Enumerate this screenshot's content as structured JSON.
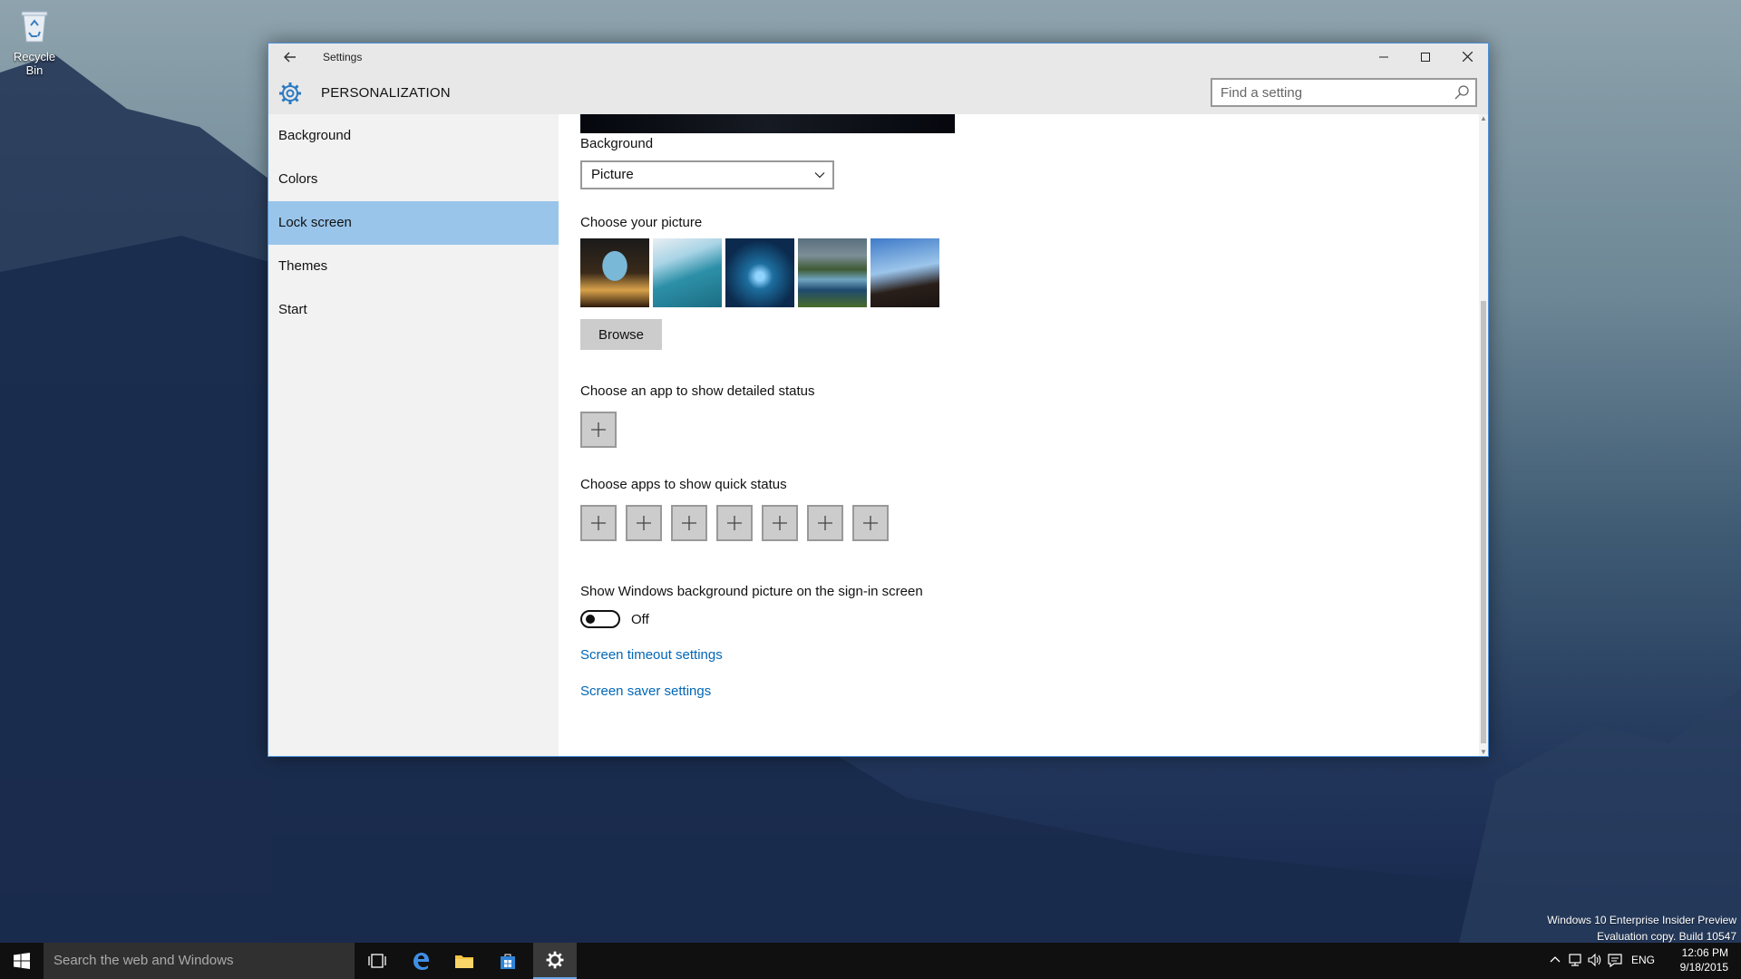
{
  "desktop": {
    "recycle_bin_label": "Recycle Bin"
  },
  "window": {
    "title": "Settings",
    "section": "PERSONALIZATION",
    "search_placeholder": "Find a setting"
  },
  "sidebar": {
    "items": [
      {
        "label": "Background",
        "active": false
      },
      {
        "label": "Colors",
        "active": false
      },
      {
        "label": "Lock screen",
        "active": true
      },
      {
        "label": "Themes",
        "active": false
      },
      {
        "label": "Start",
        "active": false
      }
    ]
  },
  "content": {
    "background_label": "Background",
    "background_value": "Picture",
    "choose_picture_label": "Choose your picture",
    "browse_label": "Browse",
    "detailed_status_label": "Choose an app to show detailed status",
    "quick_status_label": "Choose apps to show quick status",
    "signin_label": "Show Windows background picture on the sign-in screen",
    "signin_toggle_state": "Off",
    "screen_timeout_link": "Screen timeout settings",
    "screen_saver_link": "Screen saver settings"
  },
  "watermark": {
    "line1": "Windows 10 Enterprise Insider Preview",
    "line2": "Evaluation copy. Build 10547"
  },
  "taskbar": {
    "search_placeholder": "Search the web and Windows",
    "lang": "ENG",
    "time": "12:06 PM",
    "date": "9/18/2015"
  }
}
